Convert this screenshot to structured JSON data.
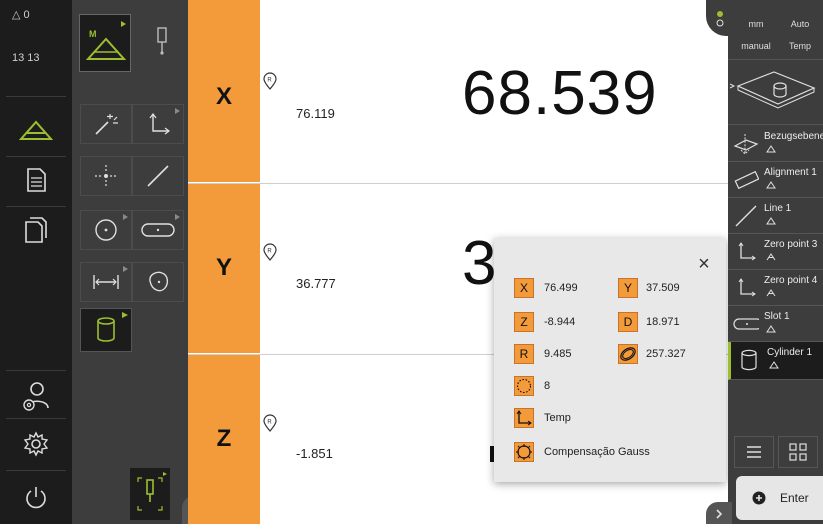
{
  "main_menu": {
    "status": {
      "warn_count": "△ 0",
      "time": "13 13"
    },
    "items": [
      "measure-icon",
      "document-icon",
      "file-management-icon",
      "user-settings-icon",
      "settings-icon",
      "power-icon"
    ]
  },
  "position_display": {
    "axes": [
      {
        "label": "X",
        "nominal": "76.119",
        "value": "68.539"
      },
      {
        "label": "Y",
        "nominal": "36.777",
        "value": "3"
      },
      {
        "label": "Z",
        "nominal": "-1.851",
        "value": ""
      }
    ]
  },
  "right_panel": {
    "top_controls": {
      "unit": "mm",
      "auto": "Auto",
      "manual": "manual",
      "temp": "Temp"
    },
    "features": [
      {
        "name": "Bezugsebene",
        "icon": "plane-icon"
      },
      {
        "name": "Alignment 1",
        "icon": "alignment-icon"
      },
      {
        "name": "Line 1",
        "icon": "line-icon"
      },
      {
        "name": "Zero point 3",
        "icon": "zero-point-icon"
      },
      {
        "name": "Zero point 4",
        "icon": "zero-point-icon"
      },
      {
        "name": "Slot 1",
        "icon": "slot-icon"
      },
      {
        "name": "Cylinder 1",
        "icon": "cylinder-icon"
      }
    ],
    "enter_label": "Enter"
  },
  "result_popup": {
    "close": "×",
    "x_label": "X",
    "x_value": "76.499",
    "y_label": "Y",
    "y_value": "37.509",
    "z_label": "Z",
    "z_value": "-8.944",
    "d_label": "D",
    "d_value": "18.971",
    "r_label": "R",
    "r_value": "9.485",
    "form_value": "257.327",
    "points_value": "8",
    "coord_system": "Temp",
    "fit_method": "Compensação Gauss"
  }
}
